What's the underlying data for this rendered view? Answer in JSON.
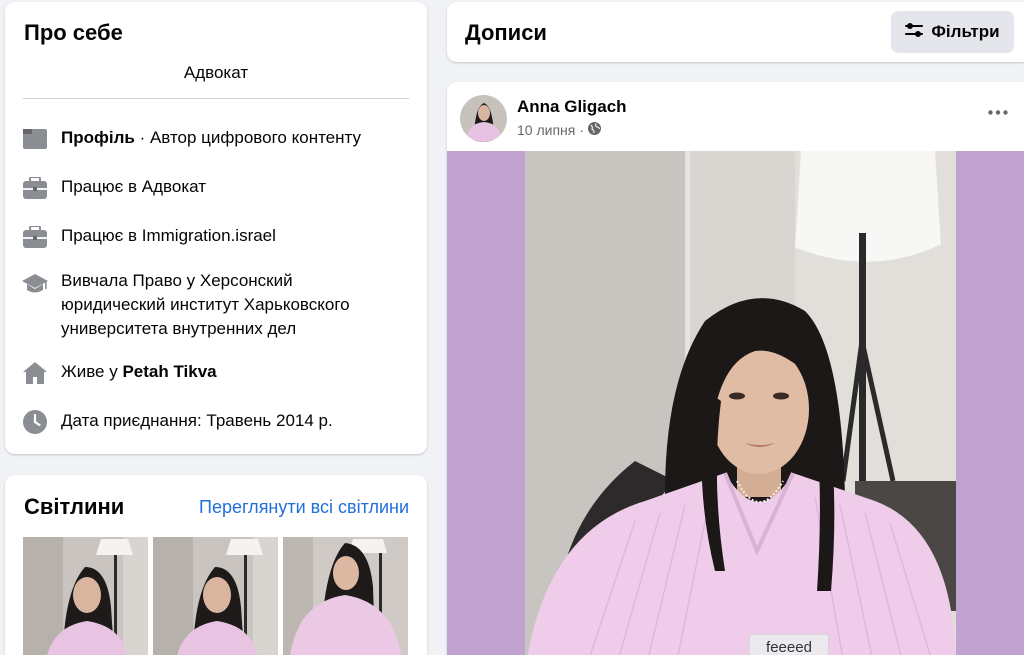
{
  "about": {
    "title": "Про себе",
    "bio": "Адвокат",
    "profile_label": "Профіль",
    "profile_sep": " · ",
    "profile_value": "Автор цифрового контенту",
    "work1": "Працює в Адвокат",
    "work2": "Працює в Immigration.israel",
    "education": "Вивчала Право у Херсонский юридический институт Харьковского университета внутренних дел",
    "lives_prefix": "Живе у ",
    "lives_city": "Petah Tikva",
    "joined": "Дата приєднання: Травень 2014 р.",
    "icons": [
      "profile-card-icon",
      "briefcase-icon",
      "briefcase-icon",
      "graduation-cap-icon",
      "home-icon",
      "clock-icon"
    ],
    "icon_color": "#8a8d91"
  },
  "photos": {
    "title": "Світлини",
    "see_all": "Переглянути всі світлини",
    "link_color": "#216fdb"
  },
  "posts": {
    "title": "Дописи",
    "filters_label": "Фільтри",
    "post": {
      "author": "Anna Gligach",
      "date": "10 липня",
      "separator": "·",
      "caption": "feeeed",
      "media_background": "#c1a3d2"
    }
  }
}
